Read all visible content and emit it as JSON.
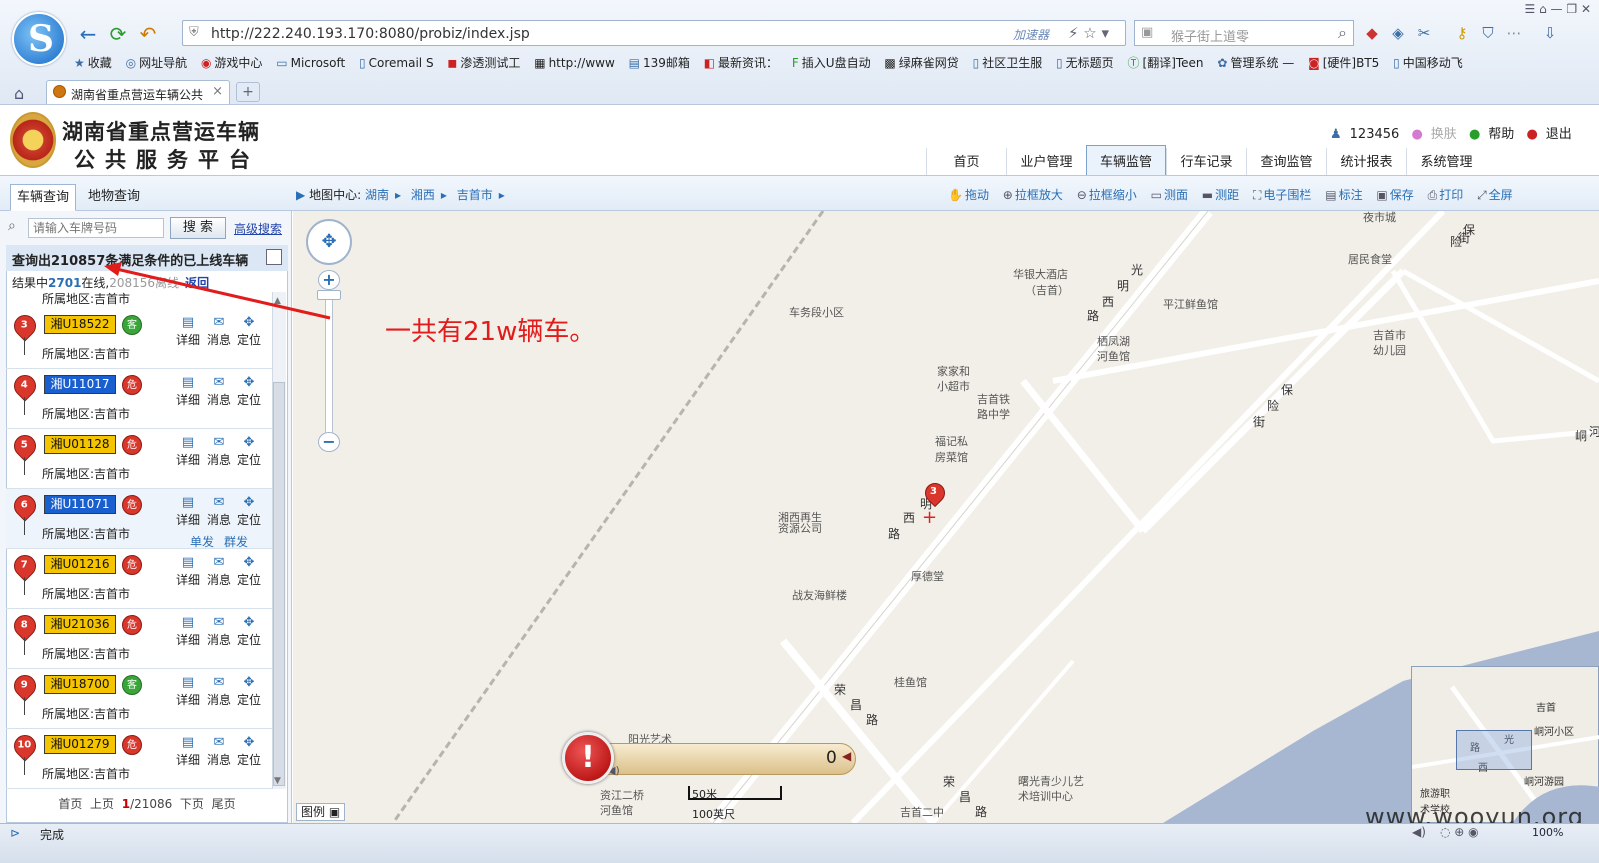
{
  "browser": {
    "url": "http://222.240.193.170:8080/probiz/index.jsp",
    "accelerator_label": "加速器",
    "search_placeholder": "猴子街上道零",
    "tab_title": "湖南省重点营运车辆公共",
    "favorites": [
      "收藏",
      "网址导航",
      "游戏中心",
      "Microsoft",
      "Coremail S",
      "渗透测试工",
      "http://www",
      "139邮箱",
      "最新资讯：",
      "插入U盘自动",
      "绿麻雀网贷",
      "社区卫生服",
      "无标题页",
      "[翻译]Teen",
      "管理系统 —",
      "[硬件]BT5",
      "中国移动飞"
    ],
    "status_text": "完成",
    "zoom_level": "100%"
  },
  "app": {
    "title_line1": "湖南省重点营运车辆",
    "title_line2": "公共服务平台",
    "username": "123456",
    "skin_label": "换肤",
    "help_label": "帮助",
    "logout_label": "退出",
    "nav": [
      "首页",
      "业户管理",
      "车辆监管",
      "行车记录",
      "查询监管",
      "统计报表",
      "系统管理"
    ],
    "nav_active": "车辆监管"
  },
  "left": {
    "tabs": [
      "车辆查询",
      "地物查询"
    ],
    "plate_placeholder": "请输入车牌号码",
    "search_button": "搜 索",
    "advanced_search": "高级搜索",
    "result_title": "查询出210857条满足条件的已上线车辆",
    "result_prefix": "结果中",
    "online_count": "2701",
    "online_suffix": "在线,",
    "offline_text": "208156离线",
    "back_link": "返回",
    "partial_region": "所属地区:吉首市",
    "vehicles": [
      {
        "num": "3",
        "plate": "湘U18522",
        "color": "yellow",
        "type": "客",
        "badge": "green",
        "region": "所属地区:吉首市"
      },
      {
        "num": "4",
        "plate": "湘U11017",
        "color": "blue",
        "type": "危",
        "badge": "red",
        "region": "所属地区:吉首市"
      },
      {
        "num": "5",
        "plate": "湘U01128",
        "color": "yellow",
        "type": "危",
        "badge": "red",
        "region": "所属地区:吉首市"
      },
      {
        "num": "6",
        "plate": "湘U11071",
        "color": "blue",
        "type": "危",
        "badge": "red",
        "region": "所属地区:吉首市"
      },
      {
        "num": "7",
        "plate": "湘U01216",
        "color": "yellow",
        "type": "危",
        "badge": "red",
        "region": "所属地区:吉首市"
      },
      {
        "num": "8",
        "plate": "湘U21036",
        "color": "yellow",
        "type": "危",
        "badge": "red",
        "region": "所属地区:吉首市"
      },
      {
        "num": "9",
        "plate": "湘U18700",
        "color": "yellow",
        "type": "客",
        "badge": "green",
        "region": "所属地区:吉首市"
      },
      {
        "num": "10",
        "plate": "湘U01279",
        "color": "yellow",
        "type": "危",
        "badge": "red",
        "region": "所属地区:吉首市"
      }
    ],
    "actions": {
      "detail": "详细",
      "message": "消息",
      "locate": "定位",
      "single": "单发",
      "group": "群发"
    },
    "pager": {
      "first": "首页",
      "prev": "上页",
      "current": "1",
      "total": "/21086",
      "next": "下页",
      "last": "尾页"
    }
  },
  "map": {
    "breadcrumb_label": "地图中心:",
    "breadcrumbs": [
      "湖南",
      "湘西",
      "吉首市"
    ],
    "tools": [
      "拖动",
      "拉框放大",
      "拉框缩小",
      "测面",
      "测距",
      "电子围栏",
      "标注",
      "保存",
      "打印",
      "全屏"
    ],
    "alert_count": "0",
    "scale_metric": "50米",
    "scale_imperial": "100英尺",
    "legend_label": "图例",
    "marker_num": "3",
    "labels": {
      "nightmarket": "夜市城",
      "canteen": "居民食堂",
      "huayin": "华银大酒店",
      "huayin2": "（吉首）",
      "pingjiang": "平江鲜鱼馆",
      "qifeng": "栖凤湖",
      "qifeng2": "河鱼馆",
      "chewu": "车务段小区",
      "jiajia": "家家和",
      "jiajia2": "小超市",
      "jstie": "吉首铁",
      "jstie2": "路中学",
      "kindergarten": "吉首市",
      "kindergarten2": "幼儿园",
      "fuji": "福记私",
      "fuji2": "房菜馆",
      "xiangxi": "湘西再生",
      "xiangxi2": "资源公司",
      "houde": "厚德堂",
      "zhanyou": "战友海鲜楼",
      "guiyu": "桂鱼馆",
      "yangguang": "阳光艺术",
      "zijiang": "资江二桥",
      "zijiang2": "河鱼馆",
      "shuguang": "曙光青少儿艺",
      "shuguang2": "术培训中心",
      "jishou2": "吉首二中"
    },
    "roads": {
      "guangming1": "光",
      "guangming2": "明",
      "guangming3": "西",
      "guangming4": "路",
      "baoxian1": "保",
      "baoxian2": "险",
      "baoxian3": "街",
      "rongchang1": "荣",
      "rongchang2": "昌",
      "rongchang3": "路",
      "rongchang4": "荣",
      "rongchang5": "昌",
      "rongchang6": "路",
      "mingxi1": "明",
      "mingxi2": "西",
      "mingxi3": "路",
      "bx1": "保",
      "bx2": "险",
      "bx3": "街",
      "he": "河",
      "dong": "峒"
    },
    "minimap_labels": {
      "jishou": "吉首",
      "tongtong": "峒河小区",
      "tonghe": "峒河游园",
      "lvyou": "旅游职",
      "lvyou2": "术学校",
      "guang": "光",
      "xi": "西",
      "lu": "路"
    }
  },
  "annotation": {
    "text": "一共有21w辆车。",
    "color": "#e21b1b"
  },
  "watermark": "www.wooyun.org"
}
